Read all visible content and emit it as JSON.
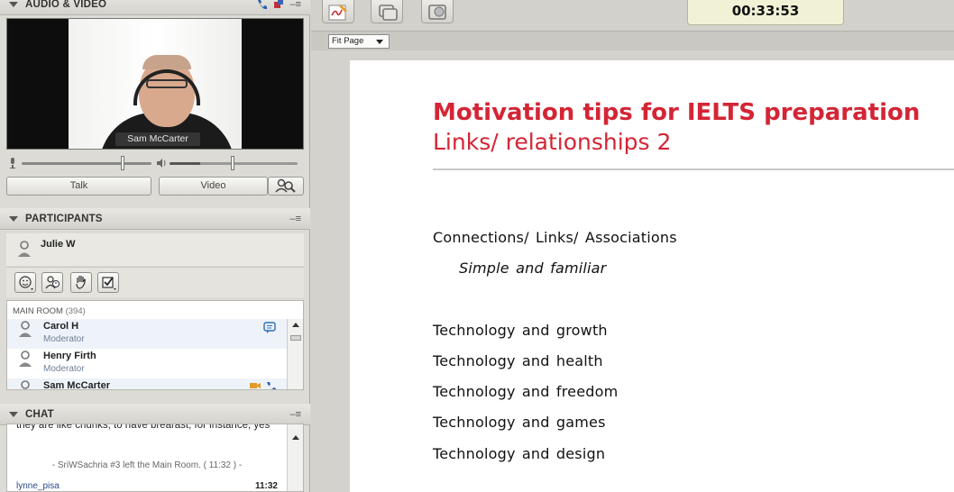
{
  "audio_video": {
    "title": "AUDIO & VIDEO",
    "menu": "–≡",
    "speaker_name": "Sam McCarter",
    "talk_label": "Talk",
    "video_label": "Video"
  },
  "participants": {
    "title": "PARTICIPANTS",
    "menu": "–≡",
    "me_name": "Julie W",
    "room_label": "MAIN ROOM",
    "room_count": "(394)",
    "list": [
      {
        "name": "Carol H",
        "role": "Moderator"
      },
      {
        "name": "Henry Firth",
        "role": "Moderator"
      },
      {
        "name": "Sam McCarter",
        "role": ""
      }
    ]
  },
  "chat": {
    "title": "CHAT",
    "menu": "–≡",
    "message": "they are like chunks, to have brearast, for instance, yes",
    "system_message": "- SriWSachria #3 left the Main Room. ( 11:32 ) -",
    "last_user": "lynne_pisa",
    "last_time": "11:32"
  },
  "toolbar": {
    "timer": "00:33:53",
    "fit_option": "Fit Page"
  },
  "slide": {
    "title": "Motivation tips for IELTS preparation",
    "subtitle": "Links/ relationships 2",
    "heading": "Connections/ Links/ Associations",
    "italic_note": "Simple and familiar",
    "items": [
      "Technology and growth",
      "Technology and health",
      "Technology and freedom",
      "Technology and games",
      "Technology and design"
    ]
  },
  "colors": {
    "slide_red": "#d42535",
    "timer_bg": "#f1f1d6",
    "panel_bg": "#dcdbd5"
  }
}
